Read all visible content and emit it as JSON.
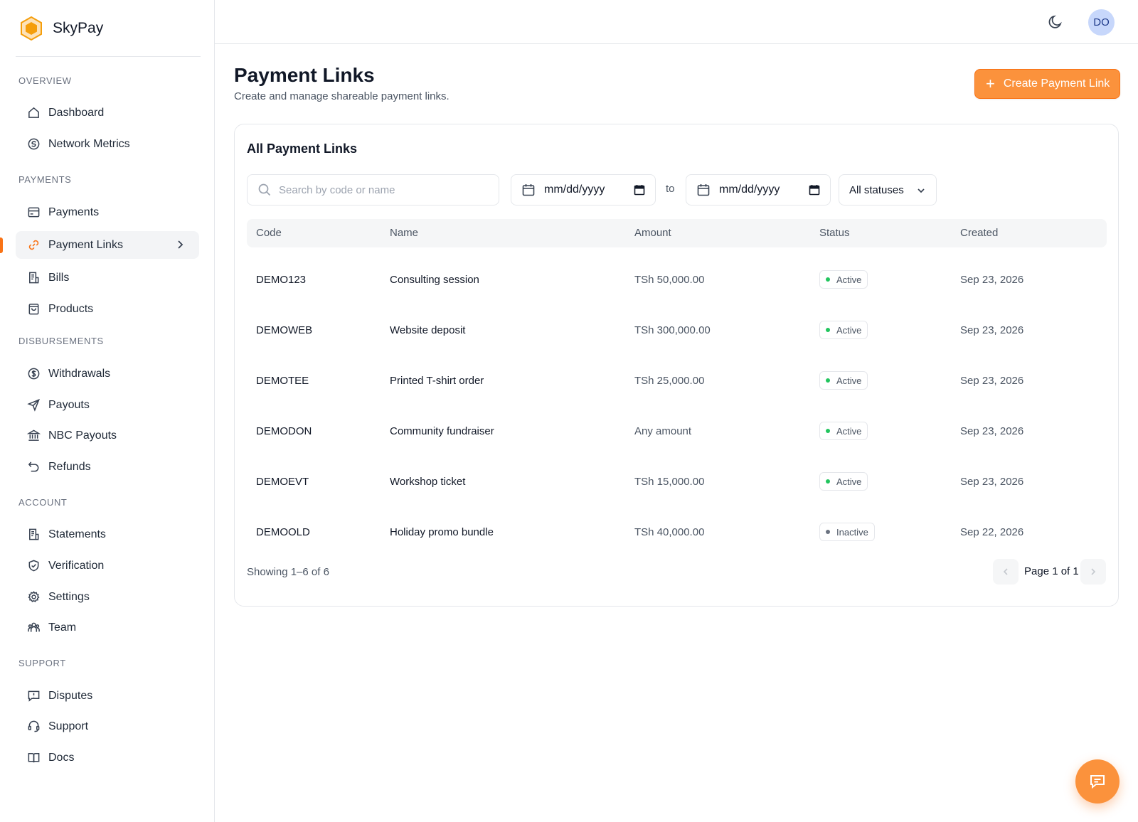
{
  "brand": {
    "name": "SkyPay",
    "logo_icon": "hexagon-logo-icon",
    "accent": "#f97316"
  },
  "sidebar": {
    "sections": [
      {
        "title": "OVERVIEW",
        "items": [
          {
            "label": "Dashboard",
            "icon": "home-icon"
          },
          {
            "label": "Network Metrics",
            "icon": "metrics-icon"
          }
        ]
      },
      {
        "title": "PAYMENTS",
        "items": [
          {
            "label": "Payments",
            "icon": "card-icon"
          },
          {
            "label": "Payment Links",
            "icon": "link-icon",
            "active": true
          },
          {
            "label": "Bills",
            "icon": "receipt-icon"
          },
          {
            "label": "Products",
            "icon": "bag-icon"
          }
        ]
      },
      {
        "title": "DISBURSEMENTS",
        "items": [
          {
            "label": "Withdrawals",
            "icon": "dollar-circle-icon"
          },
          {
            "label": "Payouts",
            "icon": "send-icon"
          },
          {
            "label": "NBC Payouts",
            "icon": "bank-icon"
          },
          {
            "label": "Refunds",
            "icon": "undo-icon"
          }
        ]
      },
      {
        "title": "ACCOUNT",
        "items": [
          {
            "label": "Statements",
            "icon": "statement-icon"
          },
          {
            "label": "Verification",
            "icon": "shield-check-icon"
          },
          {
            "label": "Settings",
            "icon": "gear-icon"
          },
          {
            "label": "Team",
            "icon": "team-icon"
          }
        ]
      },
      {
        "title": "SUPPORT",
        "items": [
          {
            "label": "Disputes",
            "icon": "alert-message-icon"
          },
          {
            "label": "Support",
            "icon": "headset-icon"
          },
          {
            "label": "Docs",
            "icon": "book-icon"
          }
        ]
      }
    ]
  },
  "topbar": {
    "avatar_initials": "DO",
    "theme_icon": "moon-icon"
  },
  "header": {
    "title": "Payment Links",
    "subtitle": "Create and manage shareable payment links.",
    "create_button": "Create Payment Link"
  },
  "card": {
    "title": "All Payment Links",
    "filters": {
      "search_placeholder": "Search by code or name",
      "date_from": "mm/dd/yyyy",
      "to_label": "to",
      "date_to": "mm/dd/yyyy",
      "status_select": "All statuses"
    },
    "columns": [
      "Code",
      "Name",
      "Amount",
      "Status",
      "Created"
    ],
    "rows": [
      {
        "code": "DEMO123",
        "name": "Consulting session",
        "amount": "TSh 50,000.00",
        "status": "Active",
        "created": "Sep 23, 2026"
      },
      {
        "code": "DEMOWEB",
        "name": "Website deposit",
        "amount": "TSh 300,000.00",
        "status": "Active",
        "created": "Sep 23, 2026"
      },
      {
        "code": "DEMOTEE",
        "name": "Printed T-shirt order",
        "amount": "TSh 25,000.00",
        "status": "Active",
        "created": "Sep 23, 2026"
      },
      {
        "code": "DEMODON",
        "name": "Community fundraiser",
        "amount": "Any amount",
        "status": "Active",
        "created": "Sep 23, 2026"
      },
      {
        "code": "DEMOEVT",
        "name": "Workshop ticket",
        "amount": "TSh 15,000.00",
        "status": "Active",
        "created": "Sep 23, 2026"
      },
      {
        "code": "DEMOOLD",
        "name": "Holiday promo bundle",
        "amount": "TSh 40,000.00",
        "status": "Inactive",
        "created": "Sep 22, 2026"
      }
    ],
    "status_colors": {
      "Active": "#22c55e",
      "Inactive": "#6b7280"
    },
    "footer": {
      "showing": "Showing 1–6 of 6",
      "page": "Page 1 of 1"
    }
  },
  "chat_button_icon": "chat-icon"
}
